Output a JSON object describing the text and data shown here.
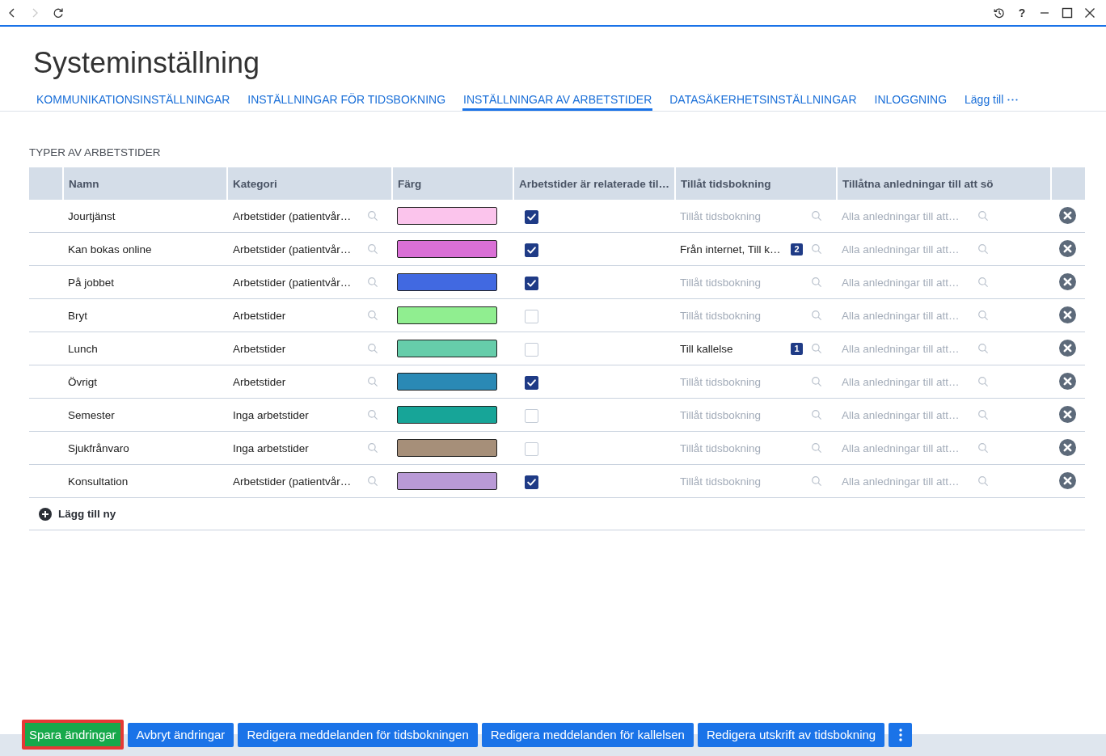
{
  "navigation": {
    "back_enabled": true,
    "forward_enabled": false
  },
  "window_controls": {
    "help": "?"
  },
  "title": "Systeminställning",
  "tabs": [
    {
      "label": "KOMMUNIKATIONSINSTÄLLNINGAR",
      "selected": false
    },
    {
      "label": "INSTÄLLNINGAR FÖR TIDSBOKNING",
      "selected": false
    },
    {
      "label": "INSTÄLLNINGAR AV ARBETSTIDER",
      "selected": true
    },
    {
      "label": "DATASÄKERHETSINSTÄLLNINGAR",
      "selected": false
    },
    {
      "label": "INLOGGNING",
      "selected": false
    }
  ],
  "add_tab": {
    "label": "Lägg till"
  },
  "section_title": "TYPER AV ARBETSTIDER",
  "table": {
    "columns": [
      "Namn",
      "Kategori",
      "Färg",
      "Arbetstider är relaterade til…",
      "Tillåt tidsbokning",
      "Tillåtna anledningar till att sö"
    ],
    "rows": [
      {
        "name": "Jourtjänst",
        "category": {
          "value": "Arbetstider (patientvår…"
        },
        "color": "#fbc4ec",
        "checked": true,
        "booking": {
          "placeholder": "Tillåt tidsbokning"
        },
        "reasons": {
          "placeholder": "Alla anledningar till att…"
        }
      },
      {
        "name": "Kan bokas online",
        "category": {
          "value": "Arbetstider (patientvår…"
        },
        "color": "#da70d6",
        "checked": true,
        "booking": {
          "value": "Från internet, Till k…",
          "count": "2"
        },
        "reasons": {
          "placeholder": "Alla anledningar till att…"
        }
      },
      {
        "name": "På jobbet",
        "category": {
          "value": "Arbetstider (patientvår…"
        },
        "color": "#4169e1",
        "checked": true,
        "booking": {
          "placeholder": "Tillåt tidsbokning"
        },
        "reasons": {
          "placeholder": "Alla anledningar till att…"
        }
      },
      {
        "name": "Bryt",
        "category": {
          "value": "Arbetstider"
        },
        "color": "#90ee90",
        "checked": false,
        "booking": {
          "placeholder": "Tillåt tidsbokning"
        },
        "reasons": {
          "placeholder": "Alla anledningar till att…"
        }
      },
      {
        "name": "Lunch",
        "category": {
          "value": "Arbetstider"
        },
        "color": "#66cdaa",
        "checked": false,
        "booking": {
          "value": "Till kallelse",
          "count": "1"
        },
        "reasons": {
          "placeholder": "Alla anledningar till att…"
        }
      },
      {
        "name": "Övrigt",
        "category": {
          "value": "Arbetstider"
        },
        "color": "#2a89b5",
        "checked": true,
        "booking": {
          "placeholder": "Tillåt tidsbokning"
        },
        "reasons": {
          "placeholder": "Alla anledningar till att…"
        }
      },
      {
        "name": "Semester",
        "category": {
          "value": "Inga arbetstider"
        },
        "color": "#17a598",
        "checked": false,
        "booking": {
          "placeholder": "Tillåt tidsbokning"
        },
        "reasons": {
          "placeholder": "Alla anledningar till att…"
        }
      },
      {
        "name": "Sjukfrånvaro",
        "category": {
          "value": "Inga arbetstider"
        },
        "color": "#a68f79",
        "checked": false,
        "booking": {
          "placeholder": "Tillåt tidsbokning"
        },
        "reasons": {
          "placeholder": "Alla anledningar till att…"
        }
      },
      {
        "name": "Konsultation",
        "category": {
          "value": "Arbetstider (patientvår…"
        },
        "color": "#b99ad6",
        "checked": true,
        "booking": {
          "placeholder": "Tillåt tidsbokning"
        },
        "reasons": {
          "placeholder": "Alla anledningar till att…"
        }
      }
    ],
    "add_row": "Lägg till ny"
  },
  "footer": {
    "buttons": [
      {
        "label": "Spara ändringar",
        "kind": "save",
        "highlighted": true
      },
      {
        "label": "Avbryt ändringar",
        "kind": "action",
        "highlighted": false
      },
      {
        "label": "Redigera meddelanden för tidsbokningen",
        "kind": "action",
        "highlighted": false
      },
      {
        "label": "Redigera meddelanden för kallelsen",
        "kind": "action",
        "highlighted": false
      },
      {
        "label": "Redigera utskrift av tidsbokning",
        "kind": "action",
        "highlighted": false
      },
      {
        "kind": "more",
        "highlighted": false
      }
    ]
  }
}
